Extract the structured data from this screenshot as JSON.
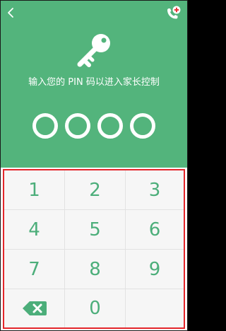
{
  "header": {
    "prompt": "输入您的 PIN 码以进入家长控制",
    "icons": {
      "back": "chevron-left-icon",
      "call": "phone-plus-icon",
      "key": "key-icon"
    }
  },
  "pin": {
    "length": 4,
    "entered": 0
  },
  "keypad": {
    "keys": [
      {
        "label": "1"
      },
      {
        "label": "2"
      },
      {
        "label": "3"
      },
      {
        "label": "4"
      },
      {
        "label": "5"
      },
      {
        "label": "6"
      },
      {
        "label": "7"
      },
      {
        "label": "8"
      },
      {
        "label": "9"
      },
      {
        "label": "",
        "icon": "backspace-icon"
      },
      {
        "label": "0"
      },
      {
        "label": ""
      }
    ]
  },
  "colors": {
    "header_bg": "#53b47c",
    "digit": "#4cae7a",
    "highlight_border": "#e3262b",
    "keypad_bg": "#f6f6f6",
    "call_badge": "#e8373a"
  }
}
